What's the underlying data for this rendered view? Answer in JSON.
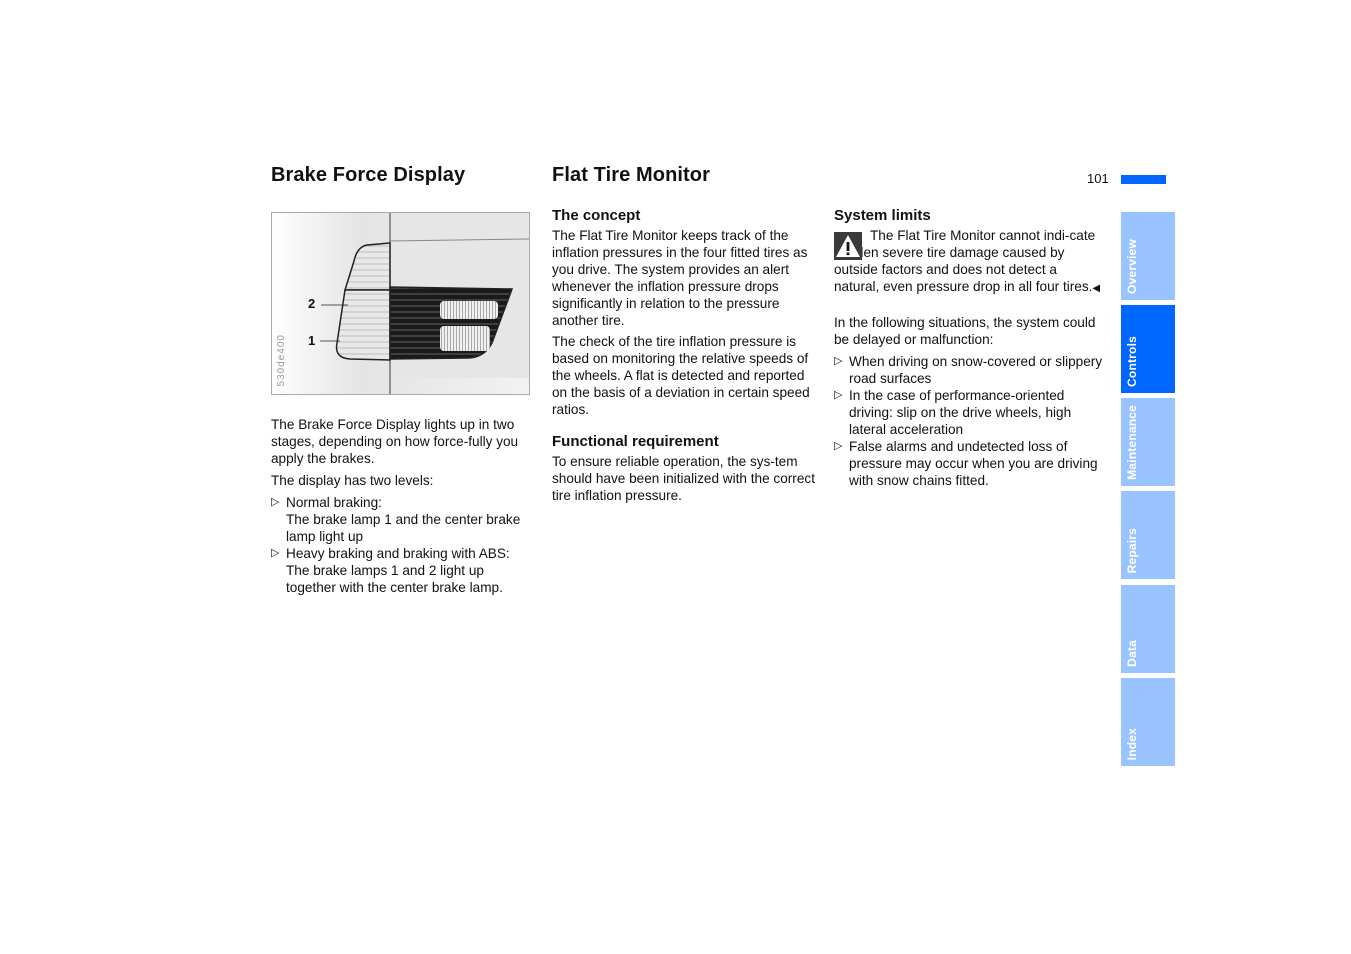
{
  "page": {
    "number": "101",
    "accent_color": "#0066ff",
    "tab_color_inactive": "#99c4ff"
  },
  "left": {
    "title": "Brake Force Display",
    "figure": {
      "id": "530de400",
      "callouts": [
        "2",
        "1"
      ]
    },
    "intro": "The Brake Force Display lights up in two stages, depending on how force-fully you apply the brakes.",
    "levels_intro": "The display has two levels:",
    "bullets": [
      {
        "head": "Normal braking:",
        "body": "The brake lamp 1 and the center brake lamp light up"
      },
      {
        "head": "Heavy braking and braking with ABS:",
        "body": "The brake lamps 1 and 2 light up together with the center brake lamp."
      }
    ]
  },
  "middle": {
    "title": "Flat Tire Monitor",
    "concept_heading": "The concept",
    "concept_p1": "The Flat Tire Monitor keeps track of the inflation pressures in the four fitted tires as you drive. The system provides an alert whenever the inflation pressure drops significantly in relation to the pressure another tire.",
    "concept_p2": "The check of the tire inflation pressure is based on monitoring the relative speeds of the wheels. A flat is detected and reported on the basis of a deviation in certain speed ratios.",
    "req_heading": "Functional requirement",
    "req_p": "To ensure reliable operation, the sys-tem should have been initialized with the correct tire inflation pressure."
  },
  "right": {
    "limits_heading": "System limits",
    "warning_icon": "warning-triangle",
    "warning_text": "The Flat Tire Monitor cannot indi-cate sudden severe tire damage caused by outside factors and does not detect a natural, even pressure drop in all four tires.",
    "end_mark": "◀",
    "situations_intro": "In the following situations, the system could be delayed or malfunction:",
    "bullets": [
      "When driving on snow-covered or slippery road surfaces",
      "In the case of performance-oriented driving: slip on the drive wheels, high lateral acceleration",
      "False alarms and undetected loss of pressure may occur when you are driving with snow chains fitted."
    ]
  },
  "bullet_glyph": "▷",
  "tabs": [
    {
      "label": "Overview",
      "active": false
    },
    {
      "label": "Controls",
      "active": true
    },
    {
      "label": "Maintenance",
      "active": false
    },
    {
      "label": "Repairs",
      "active": false
    },
    {
      "label": "Data",
      "active": false
    },
    {
      "label": "Index",
      "active": false
    }
  ]
}
